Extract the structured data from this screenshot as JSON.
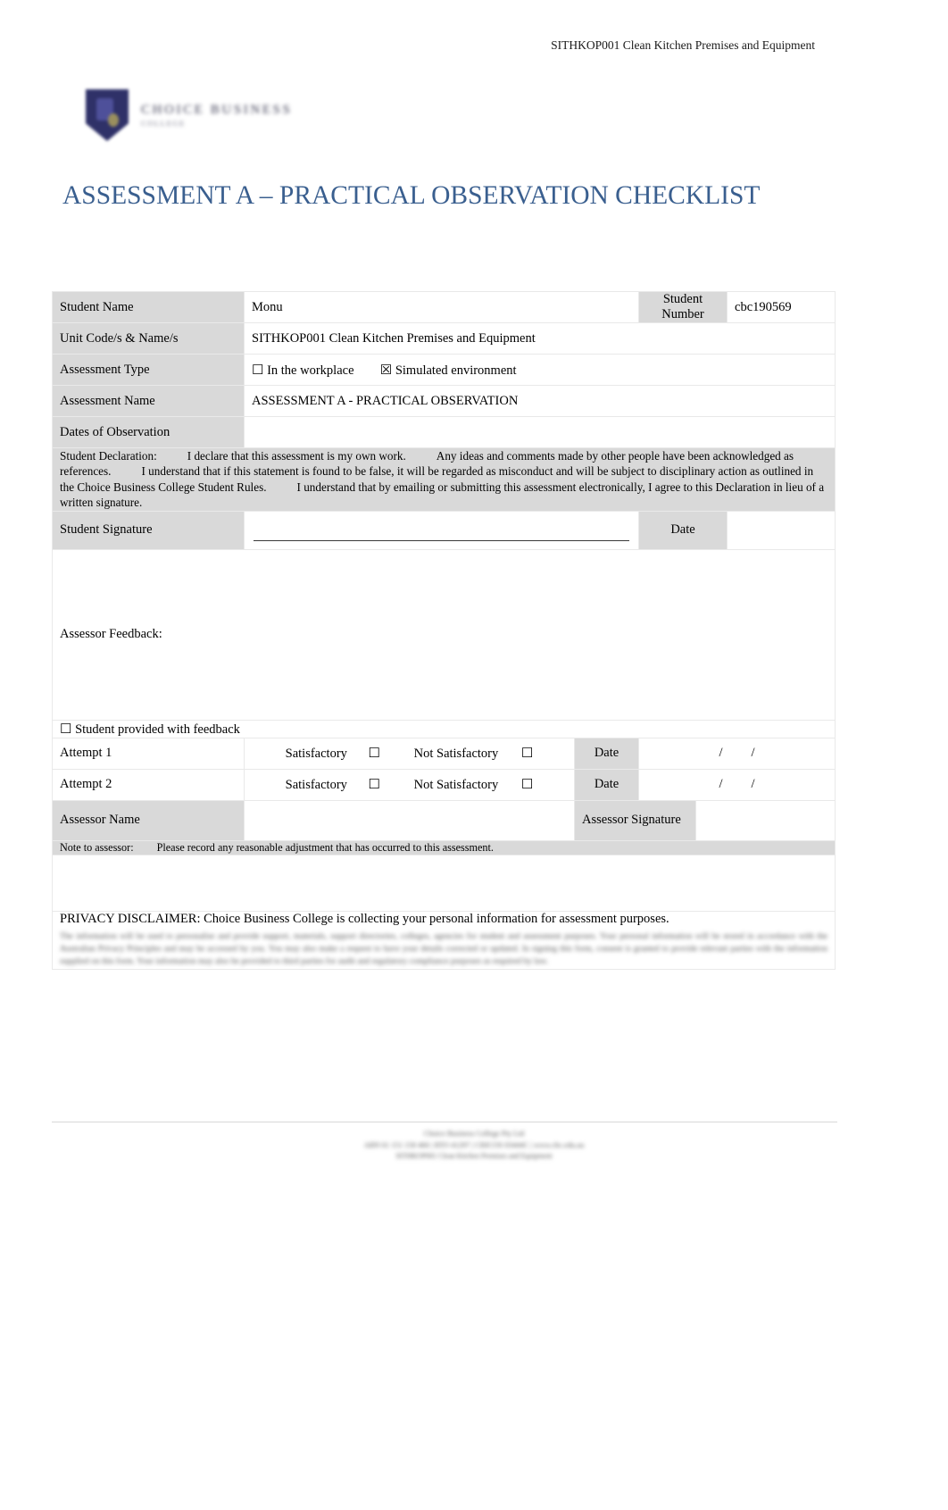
{
  "header": {
    "unit_ref": "SITHKOP001 Clean Kitchen Premises and Equipment"
  },
  "logo": {
    "name_line1": "CHOICE BUSINESS",
    "name_line2": "COLLEGE"
  },
  "title": "ASSESSMENT A – PRACTICAL OBSERVATION CHECKLIST",
  "form": {
    "student_name_label": "Student Name",
    "student_name_value": "Monu",
    "student_number_label": "Student Number",
    "student_number_value": "cbc190569",
    "unit_label": "Unit Code/s & Name/s",
    "unit_value": "SITHKOP001 Clean Kitchen Premises and Equipment",
    "assessment_type_label": "Assessment Type",
    "type_option_workplace": "In the workplace",
    "type_option_simulated": "Simulated environment",
    "checkbox_unchecked": "☐",
    "checkbox_checked": "☒",
    "assessment_name_label": "Assessment Name",
    "assessment_name_value": "ASSESSMENT A - PRACTICAL OBSERVATION",
    "dates_label": "Dates of Observation",
    "dates_value": "",
    "declaration_label": "Student Declaration:",
    "declaration_p1": "I declare that this assessment is my own work.",
    "declaration_p2": "Any ideas and comments made by other people have been acknowledged as references.",
    "declaration_p3": "I understand that if this statement is found to be false, it will be regarded as misconduct and will be subject to disciplinary action as outlined in the Choice Business College Student Rules.",
    "declaration_p4": "I understand that by emailing or submitting this assessment electronically, I agree to this Declaration in lieu of a written signature.",
    "student_signature_label": "Student Signature",
    "student_signature_value": "",
    "date_label": "Date",
    "student_date_value": ""
  },
  "assessor": {
    "feedback_label": "Assessor Feedback:",
    "feedback_value": "",
    "provided_feedback_label": "Student provided with feedback",
    "attempt1_label": "Attempt 1",
    "attempt2_label": "Attempt 2",
    "satisfactory_label": "Satisfactory",
    "not_satisfactory_label": "Not Satisfactory",
    "date_label": "Date",
    "date_slash": "/",
    "assessor_name_label": "Assessor Name",
    "assessor_name_value": "",
    "assessor_signature_label": "Assessor Signature",
    "assessor_signature_value": "",
    "note_label": "Note to assessor:",
    "note_text": "Please record any reasonable adjustment that has occurred to this assessment.",
    "adjustment_value": ""
  },
  "privacy": {
    "title": "PRIVACY DISCLAIMER:",
    "lead": "Choice Business College is collecting your personal information for assessment purposes.",
    "body": "The information will be used to personalise and provide support, materials, support directories, colleges, agencies for student and assessment purposes. Your personal information will be stored in accordance with the Australian Privacy Principles and may be accessed by you. You may also make a request to have your details corrected or updated. In signing this form, consent is granted to provide relevant parties with the information supplied on this form. Your information may also be provided to third parties for audit and regulatory compliance purposes as required by law."
  },
  "footer": {
    "line1": "Choice Business College Pty Ltd",
    "line2": "ABN 61 151 158 460 | RTO 41297 | CRICOS 03444C | www.cbc.edu.au",
    "line3": "SITHKOP001 Clean Kitchen Premises and Equipment"
  },
  "colors": {
    "title_blue": "#3a5f8f",
    "label_gray": "#d9d9d9",
    "grid_line": "#e9e9e9"
  }
}
